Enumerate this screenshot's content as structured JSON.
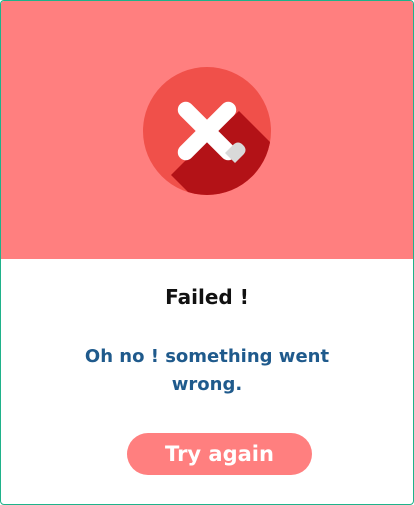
{
  "dialog": {
    "title": "Failed !",
    "message": "Oh no ! something went wrong.",
    "retry_label": "Try again",
    "icon": "close-icon"
  },
  "colors": {
    "banner": "#ff7f7f",
    "circle": "#f0504a",
    "shadow": "#b31217",
    "cross": "#ffffff",
    "message": "#1f5a8c",
    "border": "#1fb28a"
  }
}
